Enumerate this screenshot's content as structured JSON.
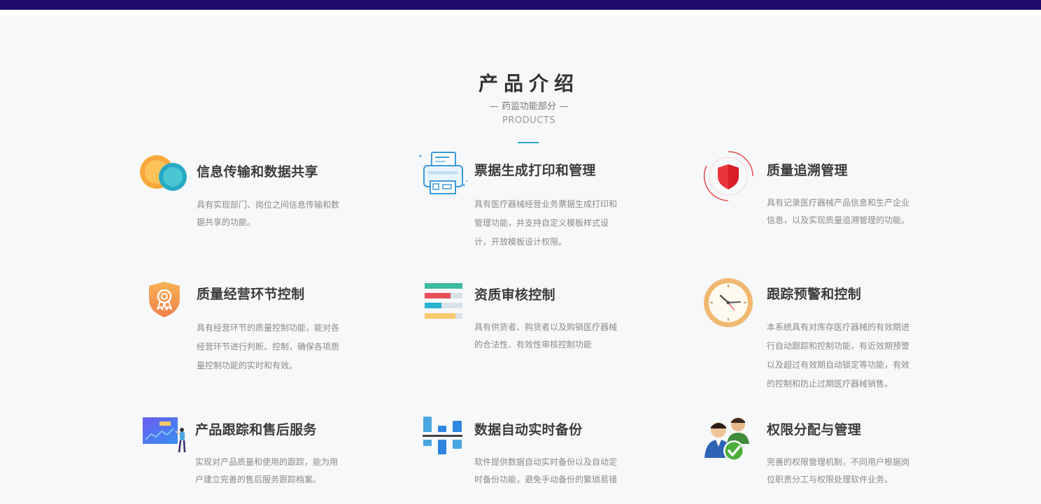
{
  "header": {
    "title": "产品介绍",
    "subtitle": "— 药监功能部分 —",
    "subtitle_en": "PRODUCTS"
  },
  "features": [
    {
      "icon": "circles-icon",
      "title": "信息传输和数据共享",
      "desc": "具有实现部门、岗位之间信息传输和数据共享的功能。"
    },
    {
      "icon": "printer-icon",
      "title": "票据生成打印和管理",
      "desc": "具有医疗器械经营业务票据生成打印和管理功能，并支持自定义模板样式设计，开放模板设计权限。"
    },
    {
      "icon": "shield-icon",
      "title": "质量追溯管理",
      "desc": "具有记录医疗器械产品信息和生产企业信息，以及实现质量追溯管理的功能。"
    },
    {
      "icon": "award-badge-icon",
      "title": "质量经营环节控制",
      "desc": "具有经营环节的质量控制功能，能对各经营环节进行判断、控制，确保各项质量控制功能的实时和有效。"
    },
    {
      "icon": "bar-list-icon",
      "title": "资质审核控制",
      "desc": "具有供货者、购货者以及购销医疗器械的合法性、有效性审核控制功能"
    },
    {
      "icon": "clock-icon",
      "title": "跟踪预警和控制",
      "desc": "本系统具有对库存医疗器械的有效期进行自动跟踪和控制功能，有近效期预警以及超过有效期自动锁定等功能，有效的控制和防止过期医疗器械销售。"
    },
    {
      "icon": "presentation-chart-icon",
      "title": "产品跟踪和售后服务",
      "desc": "实现对产品质量和使用的跟踪，能为用户建立完善的售后服务跟踪档案。"
    },
    {
      "icon": "backup-blocks-icon",
      "title": "数据自动实时备份",
      "desc": "软件提供数据自动实时备份以及自动定时备份功能，避免手动备份的繁琐易错"
    },
    {
      "icon": "users-check-icon",
      "title": "权限分配与管理",
      "desc": "完善的权限管理机制，不同用户根据岗位职责分工与权限处理软件业务。"
    }
  ],
  "colors": {
    "topbar": "#200a6a",
    "accent": "#27a9c6",
    "title_text": "#3c3c3c",
    "desc_text": "#8a8a8a"
  }
}
